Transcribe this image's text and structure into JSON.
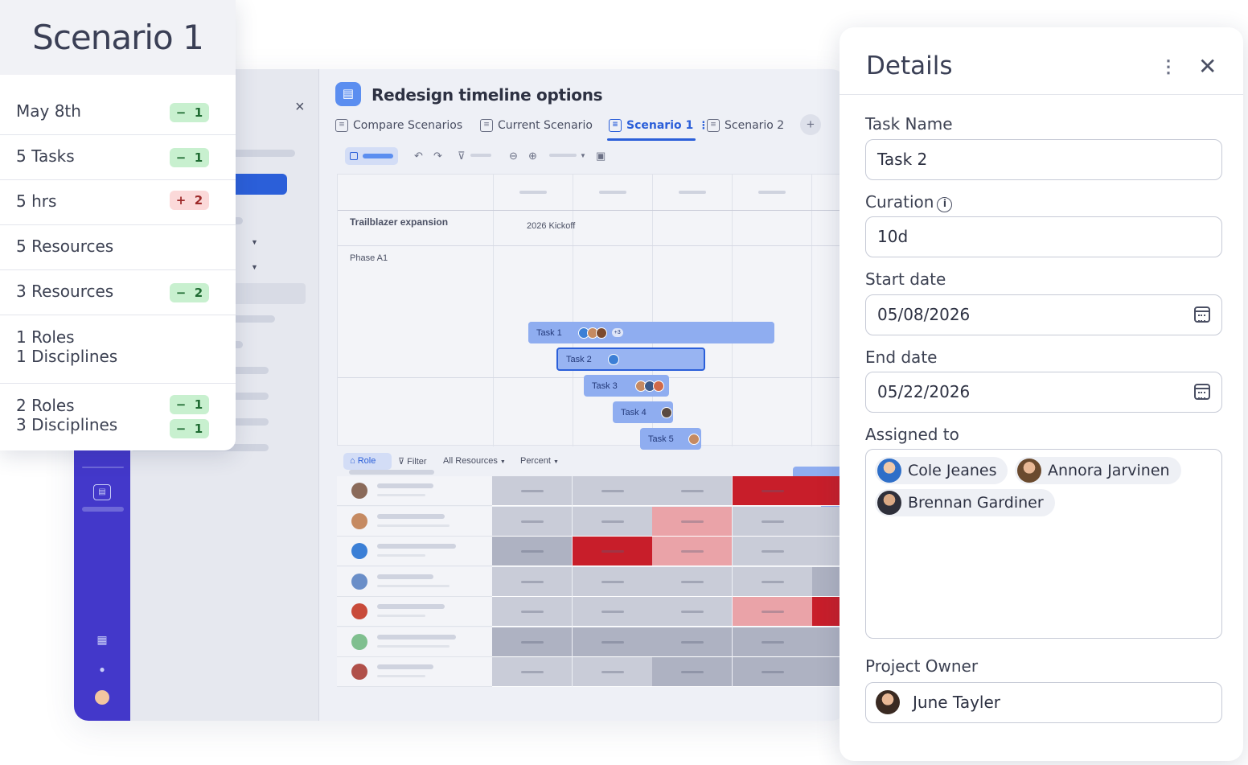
{
  "scenario_card": {
    "title": "Scenario 1",
    "rows": [
      {
        "lines": [
          "May 8th"
        ],
        "deltas": [
          {
            "sign": "−",
            "value": "1",
            "tone": "green"
          }
        ]
      },
      {
        "lines": [
          "5 Tasks"
        ],
        "deltas": [
          {
            "sign": "−",
            "value": "1",
            "tone": "green"
          }
        ]
      },
      {
        "lines": [
          "5 hrs"
        ],
        "deltas": [
          {
            "sign": "+",
            "value": "2",
            "tone": "red"
          }
        ]
      },
      {
        "lines": [
          "5 Resources"
        ],
        "deltas": []
      },
      {
        "lines": [
          "3 Resources"
        ],
        "deltas": [
          {
            "sign": "−",
            "value": "2",
            "tone": "green"
          }
        ]
      },
      {
        "lines": [
          "1 Roles",
          "1 Disciplines"
        ],
        "deltas": []
      },
      {
        "lines": [
          "2 Roles",
          "3 Disciplines"
        ],
        "deltas": [
          {
            "sign": "−",
            "value": "1",
            "tone": "green"
          },
          {
            "sign": "−",
            "value": "1",
            "tone": "green"
          }
        ]
      }
    ]
  },
  "project": {
    "title": "Redesign timeline options",
    "close_label": "×",
    "tabs": [
      {
        "label": "Compare Scenarios",
        "active": false
      },
      {
        "label": "Current Scenario",
        "active": false
      },
      {
        "label": "Scenario 1",
        "active": true
      },
      {
        "label": "Scenario 2",
        "active": false
      }
    ],
    "add_tab_label": "+"
  },
  "gantt": {
    "group": "Trailblazer expansion",
    "phase": "Phase A1",
    "milestone": "2026 Kickoff",
    "tasks": [
      {
        "label": "Task 1",
        "extra": "+3"
      },
      {
        "label": "Task 2",
        "extra": ""
      },
      {
        "label": "Task 3",
        "extra": ""
      },
      {
        "label": "Task 4",
        "extra": ""
      },
      {
        "label": "Task 5",
        "extra": ""
      }
    ]
  },
  "resource_toolbar": {
    "role": "Role",
    "filter": "Filter",
    "resources": "All Resources",
    "percent": "Percent"
  },
  "details": {
    "title": "Details",
    "task_name_label": "Task Name",
    "task_name_value": "Task 2",
    "duration_label": "Curation",
    "duration_value": "10d",
    "start_label": "Start date",
    "start_value": "05/08/2026",
    "end_label": "End date",
    "end_value": "05/22/2026",
    "assigned_label": "Assigned to",
    "assignees": [
      "Cole Jeanes",
      "Annora Jarvinen",
      "Brennan Gardiner"
    ],
    "owner_label": "Project Owner",
    "owner_value": "June Tayler"
  },
  "colors": {
    "rail": "#4338ca",
    "accent": "#2b5fd9",
    "bar": "#8fadf0",
    "heat_high": "#c81e2a",
    "heat_mid": "#eaa3a8",
    "heat_low": "#c9ccd8",
    "pill_green": "#c8f0cf",
    "pill_red": "#fbd9d9"
  }
}
